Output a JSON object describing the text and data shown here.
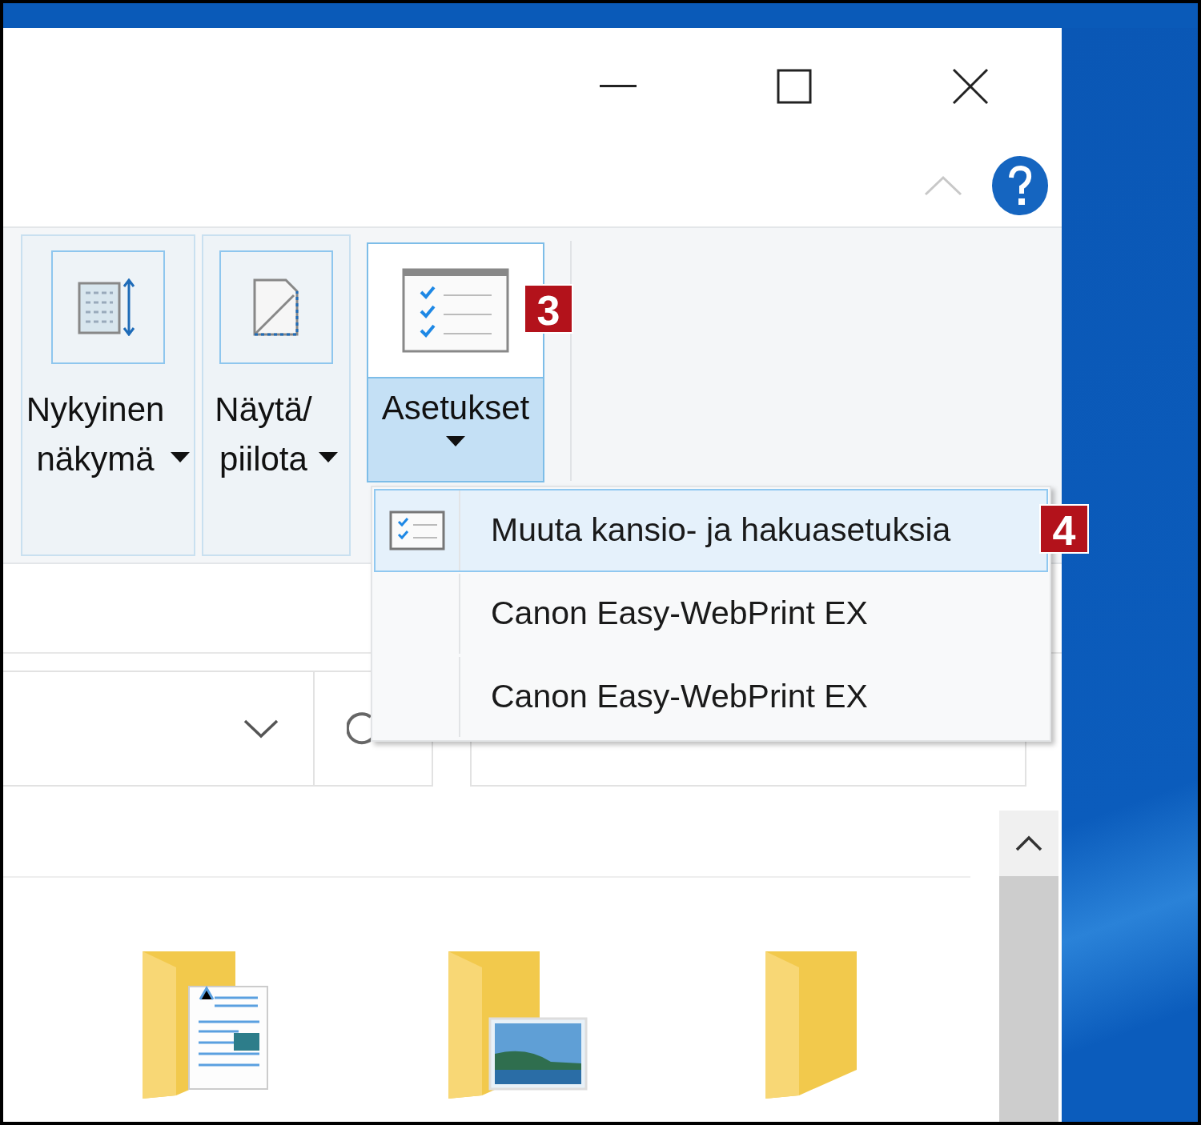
{
  "ribbon": {
    "buttons": [
      {
        "label": "Nykyinen näkymä",
        "kind": "view",
        "selected": false
      },
      {
        "label": "Näytä/ piilota",
        "kind": "showhide",
        "selected": false
      },
      {
        "label": "Asetukset",
        "kind": "options",
        "selected": true,
        "badge": "3"
      }
    ]
  },
  "options_menu": {
    "items": [
      {
        "label": "Muuta kansio- ja hakuasetuksia",
        "has_icon": true,
        "selected": true,
        "badge": "4"
      },
      {
        "label": "Canon Easy-WebPrint EX",
        "has_icon": false,
        "selected": false
      },
      {
        "label": "Canon Easy-WebPrint EX",
        "has_icon": false,
        "selected": false
      }
    ]
  },
  "folders": [
    {
      "kind": "documents"
    },
    {
      "kind": "pictures"
    },
    {
      "kind": "plain"
    }
  ]
}
